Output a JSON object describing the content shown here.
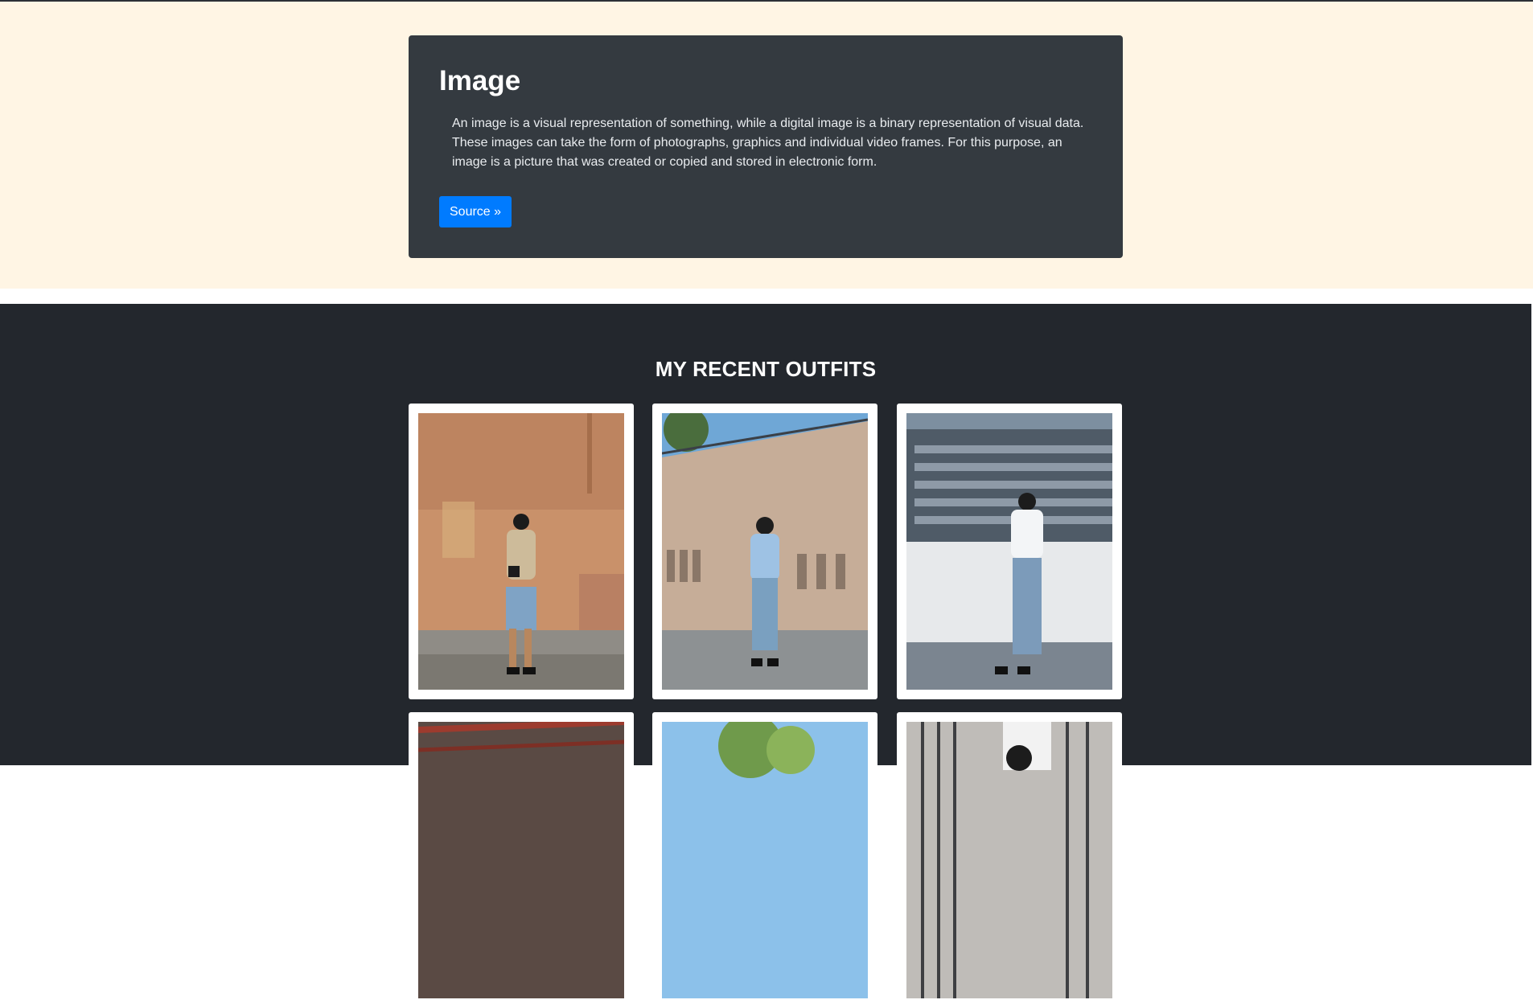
{
  "hero": {
    "title": "Image",
    "text": "An image is a visual representation of something, while a digital image is a binary representation of visual data. These images can take the form of photographs, graphics and individual video frames. For this purpose, an image is a picture that was created or copied and stored in electronic form.",
    "button_label": "Source »"
  },
  "gallery": {
    "heading": "MY RECENT OUTFITS",
    "photos": [
      {
        "id": "outfit-1",
        "kind": "photo"
      },
      {
        "id": "outfit-2",
        "kind": "photo"
      },
      {
        "id": "outfit-3",
        "kind": "photo"
      },
      {
        "id": "outfit-4",
        "kind": "photo"
      },
      {
        "id": "outfit-5",
        "kind": "photo"
      },
      {
        "id": "outfit-6",
        "kind": "photo"
      }
    ]
  },
  "colors": {
    "hero_background": "#fff5e4",
    "card_background": "#343a40",
    "button": "#007bff",
    "gallery_background": "#23272d"
  }
}
